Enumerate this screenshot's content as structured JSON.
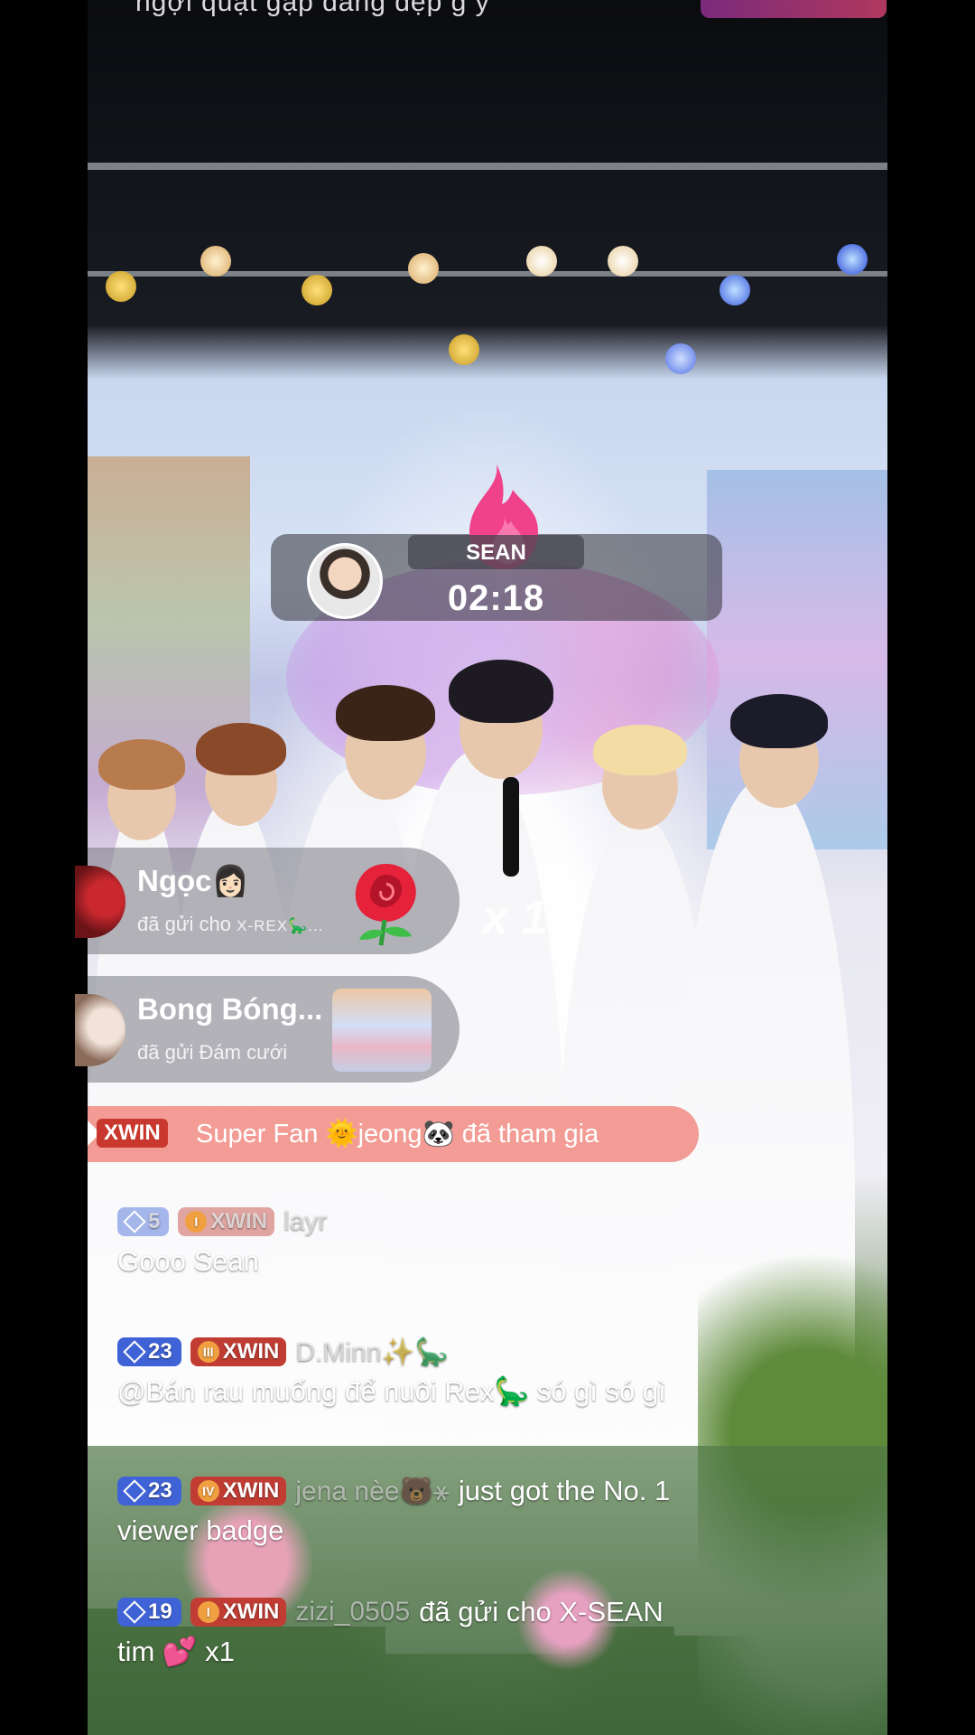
{
  "stream": {
    "top_text": "ngợi quạt gặp đảng đẹp g y"
  },
  "countdown": {
    "name": "SEAN",
    "time": "02:18"
  },
  "gifts": [
    {
      "name": "Ngọc👩🏻",
      "sub_prefix": "đã gửi cho ",
      "sub_target": "X-REX🦕...",
      "icon": "rose-icon",
      "multiplier": "x 1"
    },
    {
      "name": "Bong Bóng...",
      "sub_prefix": "đã gửi Đám cưới",
      "sub_target": "",
      "icon": "wedding-cake-icon"
    }
  ],
  "join": {
    "badge": "XWIN",
    "text": "Super Fan 🌞jeong🐼 đã tham gia"
  },
  "chat": [
    {
      "level": "5",
      "level_faded": true,
      "fan_tier": "I",
      "fan_label": "XWIN",
      "fan_faded": true,
      "user": "layr",
      "message": "Gooo Sean"
    },
    {
      "level": "23",
      "fan_tier": "III",
      "fan_label": "XWIN",
      "user": "D.Minn✨🦕",
      "message": "@Bán rau muống để nuôi Rex🦕 só gì só gì"
    },
    {
      "level": "23",
      "fan_tier": "IV",
      "fan_label": "XWIN",
      "user": "jena nèe🐻⚹",
      "inline": "just got the No. 1",
      "message": "viewer badge"
    },
    {
      "level": "19",
      "fan_tier": "I",
      "fan_label": "XWIN",
      "user": "zizi_0505",
      "inline": "đã gửi cho X-SEAN",
      "message": "tim 💕 x1"
    }
  ],
  "colors": {
    "level_badge": "#3f63d6",
    "fan_badge": "#c13d33",
    "join_banner": "#f08278",
    "gift_bubble": "#78787f"
  }
}
